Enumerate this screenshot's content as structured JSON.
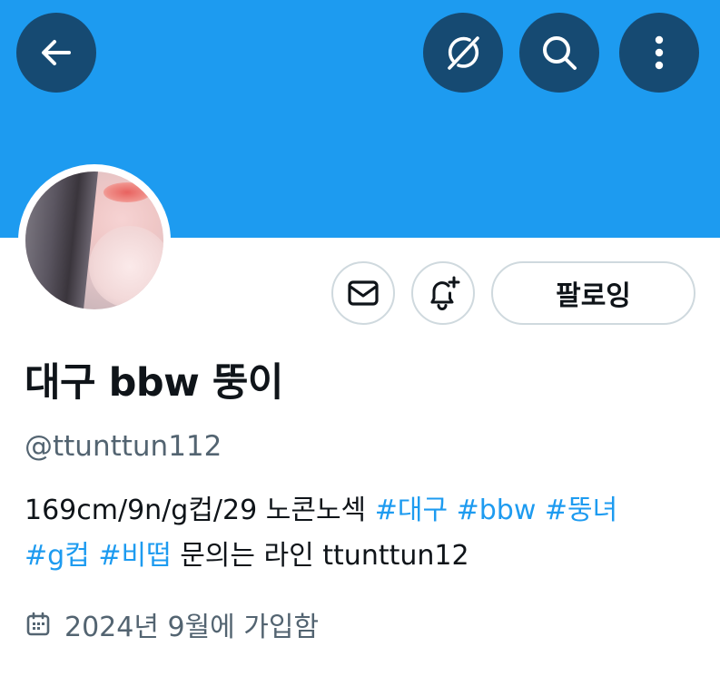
{
  "colors": {
    "banner": "#1d9bf0",
    "button_dark": "#164a72",
    "link": "#1d9bf0",
    "secondary_text": "#536471",
    "border": "#cfd9de"
  },
  "header": {
    "back_icon": "arrow-left-icon",
    "grok_icon": "grok-icon",
    "search_icon": "search-icon",
    "more_icon": "more-vertical-icon"
  },
  "actions": {
    "message_icon": "envelope-icon",
    "notify_icon": "bell-plus-icon",
    "following_label": "팔로잉"
  },
  "profile": {
    "display_name": "대구 bbw 뚱이",
    "handle": "@ttunttun112",
    "bio": {
      "text_1": "169cm/9n/g컵/29 노콘노섹 ",
      "tag_1": "#대구",
      "tag_2": "#bbw",
      "tag_3": "#뚱녀",
      "tag_4": "#g컵",
      "tag_5": "#비떱",
      "text_2": " 문의는 라인 ttunttun12"
    },
    "joined_icon": "calendar-icon",
    "joined": "2024년 9월에 가입함"
  }
}
